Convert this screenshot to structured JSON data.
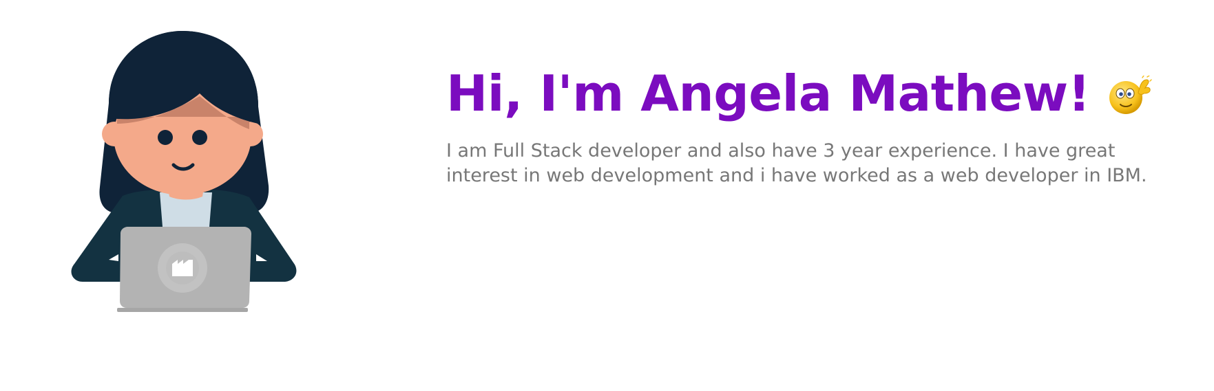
{
  "hero": {
    "title": "Hi, I'm Angela Mathew!",
    "intro": "I am Full Stack developer and also have 3 year experience. I have great interest in web development and i have worked as a web developer in IBM."
  },
  "icons": {
    "avatar": "developer-avatar-icon",
    "laptop": "laptop-icon",
    "laptop_logo": "factory-icon",
    "wave": "waving-smiley-icon"
  },
  "colors": {
    "accent": "#7b0cbf",
    "muted_text": "#777777",
    "hair": "#0f2338",
    "skin": "#f4a98a",
    "jacket": "#133241",
    "shirt": "#cfdde6",
    "laptop": "#b3b3b3"
  }
}
